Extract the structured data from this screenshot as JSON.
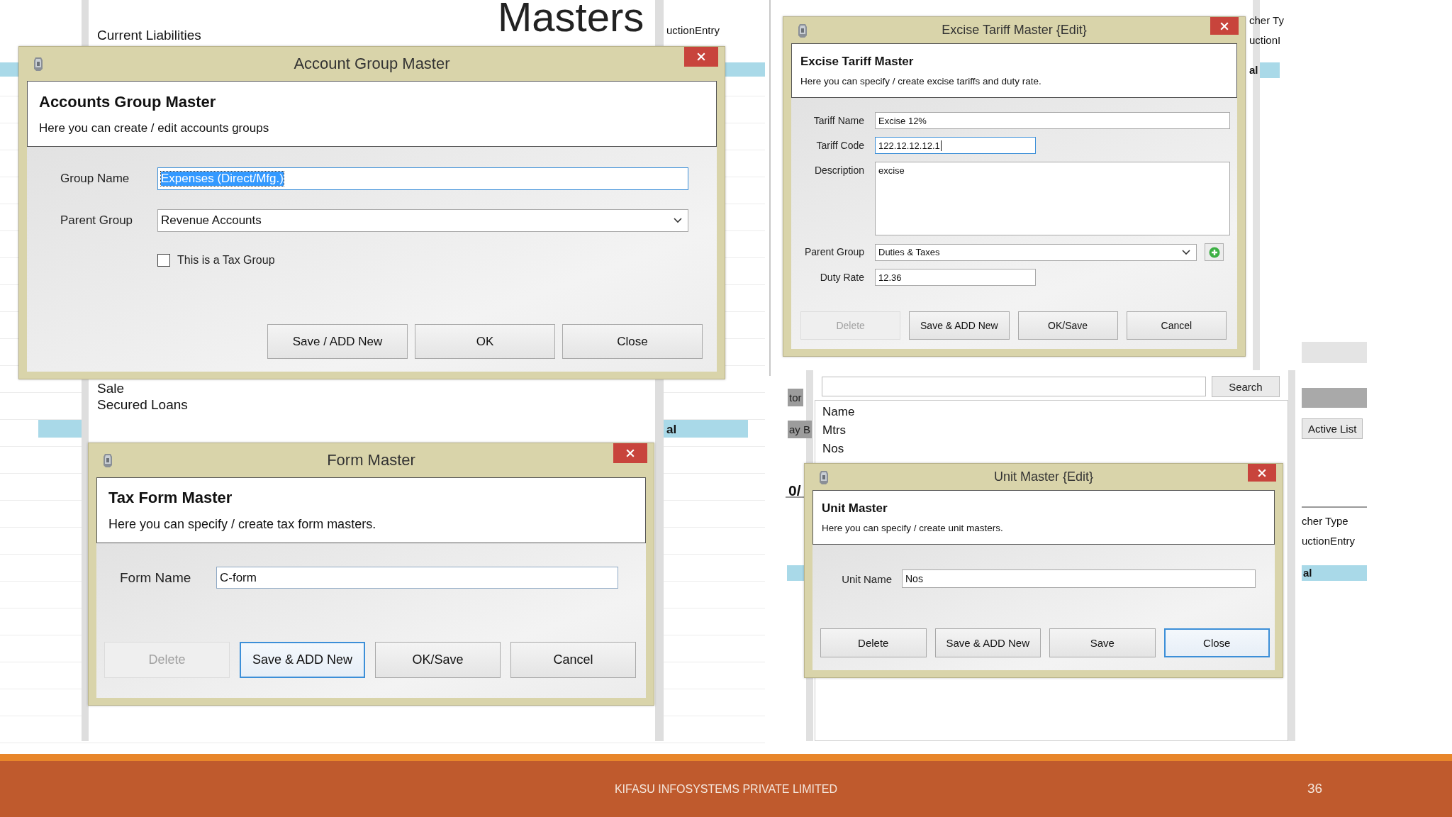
{
  "slide_title": "Masters",
  "background": {
    "left_list": [
      "Current Liabilities",
      "Sale",
      "Secured Loans"
    ],
    "unit_list": {
      "search_button": "Search",
      "header": "Name",
      "rows": [
        "Mtrs",
        "Nos"
      ]
    },
    "fragments": [
      {
        "text": "uctionEntry",
        "kind": "plain"
      },
      {
        "text": "al",
        "kind": "bold"
      },
      {
        "text": "cher Ty",
        "kind": "plain"
      },
      {
        "text": "uctionI",
        "kind": "plain"
      },
      {
        "text": "al",
        "kind": "bold"
      },
      {
        "text": "tor",
        "kind": "tab"
      },
      {
        "text": "ay B",
        "kind": "tab"
      },
      {
        "text": "0/",
        "kind": "bold"
      },
      {
        "text": "Active List",
        "kind": "button"
      },
      {
        "text": "cher Type",
        "kind": "plain"
      },
      {
        "text": "uctionEntry",
        "kind": "plain"
      },
      {
        "text": "al",
        "kind": "bold"
      }
    ]
  },
  "dialogs": [
    {
      "title": "Account Group Master",
      "heading": "Accounts Group Master",
      "description": "Here you can create / edit  accounts groups",
      "fields": [
        {
          "kind": "text",
          "label": "Group Name",
          "value": "Expenses (Direct/Mfg.)",
          "focused": true,
          "text_selected": true
        },
        {
          "kind": "combo",
          "label": "Parent Group",
          "value": "Revenue Accounts",
          "focused": false,
          "text_selected": false,
          "add_button": false
        },
        {
          "kind": "checkbox",
          "label": "This is a Tax Group",
          "checked": false
        }
      ],
      "buttons": [
        {
          "label": "Save / ADD New",
          "disabled": false,
          "focused": false
        },
        {
          "label": "OK",
          "disabled": false,
          "focused": false
        },
        {
          "label": "Close",
          "disabled": false,
          "focused": false
        }
      ]
    },
    {
      "title": "Form Master",
      "heading": "Tax Form Master",
      "description": "Here you can specify / create tax form masters.",
      "fields": [
        {
          "kind": "text",
          "label": "Form Name",
          "value": "C-form",
          "focused": false,
          "text_selected": false
        }
      ],
      "buttons": [
        {
          "label": "Delete",
          "disabled": true,
          "focused": false
        },
        {
          "label": "Save & ADD New",
          "disabled": false,
          "focused": true
        },
        {
          "label": "OK/Save",
          "disabled": false,
          "focused": false
        },
        {
          "label": "Cancel",
          "disabled": false,
          "focused": false
        }
      ]
    },
    {
      "title": "Excise Tariff Master {Edit}",
      "heading": "Excise Tariff Master",
      "description": "Here you can specify / create excise tariffs and duty rate.",
      "fields": [
        {
          "kind": "text",
          "label": "Tariff Name",
          "value": "Excise 12%",
          "focused": false,
          "text_selected": false
        },
        {
          "kind": "text",
          "label": "Tariff Code",
          "value": "122.12.12.12.1",
          "focused": true,
          "text_selected": false
        },
        {
          "kind": "textarea",
          "label": "Description",
          "value": "excise",
          "focused": false,
          "text_selected": false
        },
        {
          "kind": "combo",
          "label": "Parent Group",
          "value": "Duties & Taxes",
          "focused": false,
          "text_selected": false,
          "add_button": true
        },
        {
          "kind": "text",
          "label": "Duty Rate",
          "value": "12.36",
          "focused": false,
          "text_selected": false
        }
      ],
      "buttons": [
        {
          "label": "Delete",
          "disabled": true,
          "focused": false
        },
        {
          "label": "Save & ADD New",
          "disabled": false,
          "focused": false
        },
        {
          "label": "OK/Save",
          "disabled": false,
          "focused": false
        },
        {
          "label": "Cancel",
          "disabled": false,
          "focused": false
        }
      ]
    },
    {
      "title": "Unit Master {Edit}",
      "heading": "Unit Master",
      "description": "Here you can specify / create unit masters.",
      "fields": [
        {
          "kind": "text",
          "label": "Unit Name",
          "value": "Nos",
          "focused": false,
          "text_selected": false
        }
      ],
      "buttons": [
        {
          "label": "Delete",
          "disabled": false,
          "focused": false
        },
        {
          "label": "Save & ADD New",
          "disabled": false,
          "focused": false
        },
        {
          "label": "Save",
          "disabled": false,
          "focused": false
        },
        {
          "label": "Close",
          "disabled": false,
          "focused": true
        }
      ]
    }
  ],
  "footer": {
    "company": "KIFASU INFOSYSTEMS PRIVATE LIMITED",
    "page_number": "36"
  }
}
